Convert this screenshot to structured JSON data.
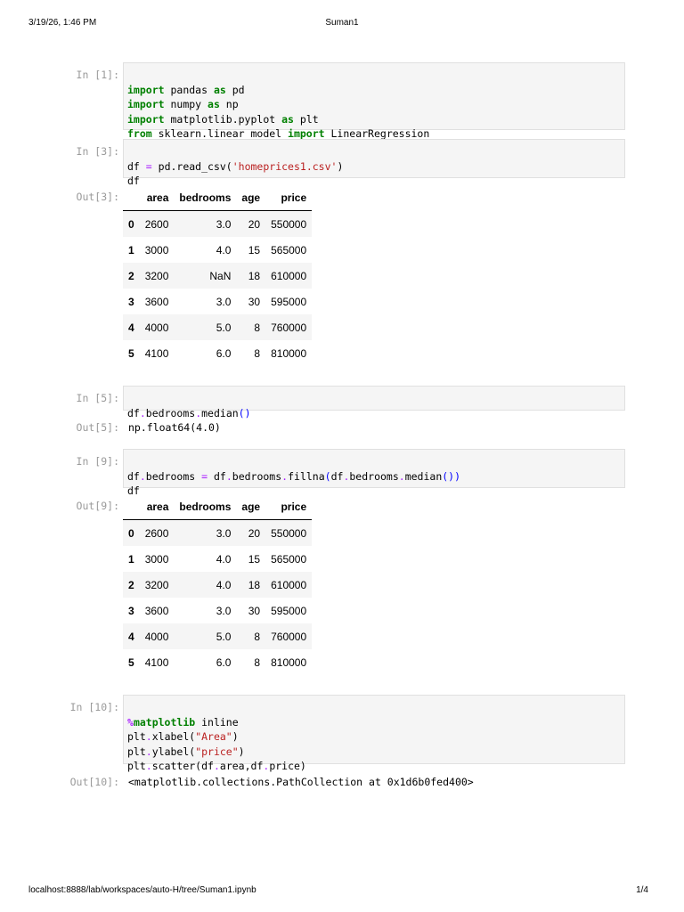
{
  "print_header": {
    "datetime": "3/19/26, 1:46 PM",
    "title": "Suman1"
  },
  "print_footer": {
    "url": "localhost:8888/lab/workspaces/auto-H/tree/Suman1.ipynb",
    "page": "1/4"
  },
  "cells": {
    "in1": {
      "prompt": "In [1]:",
      "lines": [
        "import pandas as pd",
        "import numpy as np",
        "import matplotlib.pyplot as plt",
        "from sklearn.linear_model import LinearRegression"
      ]
    },
    "in3": {
      "prompt": "In [3]:",
      "lines": [
        "df = pd.read_csv('homeprices1.csv')",
        "df"
      ]
    },
    "out3": {
      "prompt": "Out[3]:",
      "columns": [
        "",
        "area",
        "bedrooms",
        "age",
        "price"
      ],
      "rows": [
        [
          "0",
          "2600",
          "3.0",
          "20",
          "550000"
        ],
        [
          "1",
          "3000",
          "4.0",
          "15",
          "565000"
        ],
        [
          "2",
          "3200",
          "NaN",
          "18",
          "610000"
        ],
        [
          "3",
          "3600",
          "3.0",
          "30",
          "595000"
        ],
        [
          "4",
          "4000",
          "5.0",
          "8",
          "760000"
        ],
        [
          "5",
          "4100",
          "6.0",
          "8",
          "810000"
        ]
      ]
    },
    "in5": {
      "prompt": "In [5]:",
      "lines": [
        "df.bedrooms.median()"
      ]
    },
    "out5": {
      "prompt": "Out[5]:",
      "text": "np.float64(4.0)"
    },
    "in9": {
      "prompt": "In [9]:",
      "lines": [
        "df.bedrooms = df.bedrooms.fillna(df.bedrooms.median())",
        "df"
      ]
    },
    "out9": {
      "prompt": "Out[9]:",
      "columns": [
        "",
        "area",
        "bedrooms",
        "age",
        "price"
      ],
      "rows": [
        [
          "0",
          "2600",
          "3.0",
          "20",
          "550000"
        ],
        [
          "1",
          "3000",
          "4.0",
          "15",
          "565000"
        ],
        [
          "2",
          "3200",
          "4.0",
          "18",
          "610000"
        ],
        [
          "3",
          "3600",
          "3.0",
          "30",
          "595000"
        ],
        [
          "4",
          "4000",
          "5.0",
          "8",
          "760000"
        ],
        [
          "5",
          "4100",
          "6.0",
          "8",
          "810000"
        ]
      ]
    },
    "in10": {
      "prompt": "In [10]:",
      "lines": [
        "%matplotlib inline",
        "plt.xlabel(\"Area\")",
        "plt.ylabel(\"price\")",
        "plt.scatter(df.area,df.price)"
      ]
    },
    "out10": {
      "prompt": "Out[10]:",
      "text": "<matplotlib.collections.PathCollection at 0x1d6b0fed400>"
    }
  }
}
